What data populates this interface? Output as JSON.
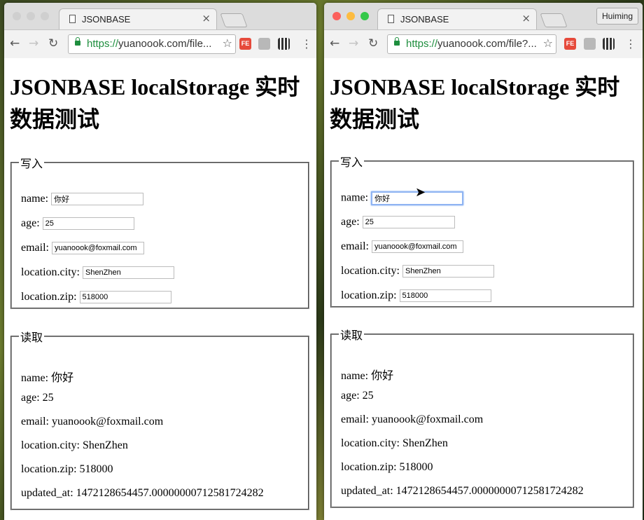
{
  "windows": [
    {
      "tab_title": "JSONBASE",
      "url_scheme": "https://",
      "url_rest": "yuanoook.com/file...",
      "heading": "JSONBASE localStorage 实时数据测试",
      "write_legend": "写入",
      "read_legend": "读取",
      "fields": [
        {
          "label": "name:",
          "value": "你好"
        },
        {
          "label": "age:",
          "value": "25"
        },
        {
          "label": "email:",
          "value": "yuanoook@foxmail.com"
        },
        {
          "label": "location.city:",
          "value": "ShenZhen"
        },
        {
          "label": "location.zip:",
          "value": "518000"
        }
      ],
      "readout": [
        "name: 你好",
        "age: 25",
        "email: yuanoook@foxmail.com",
        "location.city: ShenZhen",
        "location.zip: 518000",
        "updated_at: 1472128654457.00000000712581724282"
      ]
    },
    {
      "tab_title": "JSONBASE",
      "url_scheme": "https://",
      "url_rest": "yuanoook.com/file?...",
      "profile_name": "Huiming",
      "heading": "JSONBASE localStorage 实时数据测试",
      "write_legend": "写入",
      "read_legend": "读取",
      "fields": [
        {
          "label": "name:",
          "value": "你好"
        },
        {
          "label": "age:",
          "value": "25"
        },
        {
          "label": "email:",
          "value": "yuanoook@foxmail.com"
        },
        {
          "label": "location.city:",
          "value": "ShenZhen"
        },
        {
          "label": "location.zip:",
          "value": "518000"
        }
      ],
      "readout": [
        "name: 你好",
        "age: 25",
        "email: yuanoook@foxmail.com",
        "location.city: ShenZhen",
        "location.zip: 518000",
        "updated_at: 1472128654457.00000000712581724282"
      ]
    }
  ],
  "colors": {
    "close_red": "#fc605c",
    "minimize_yellow": "#fdbc40",
    "zoom_green": "#34c84a",
    "inactive_gray": "#cfcfcf",
    "secure_green": "#1e8e3e",
    "focus_blue": "#8fb4f2"
  }
}
